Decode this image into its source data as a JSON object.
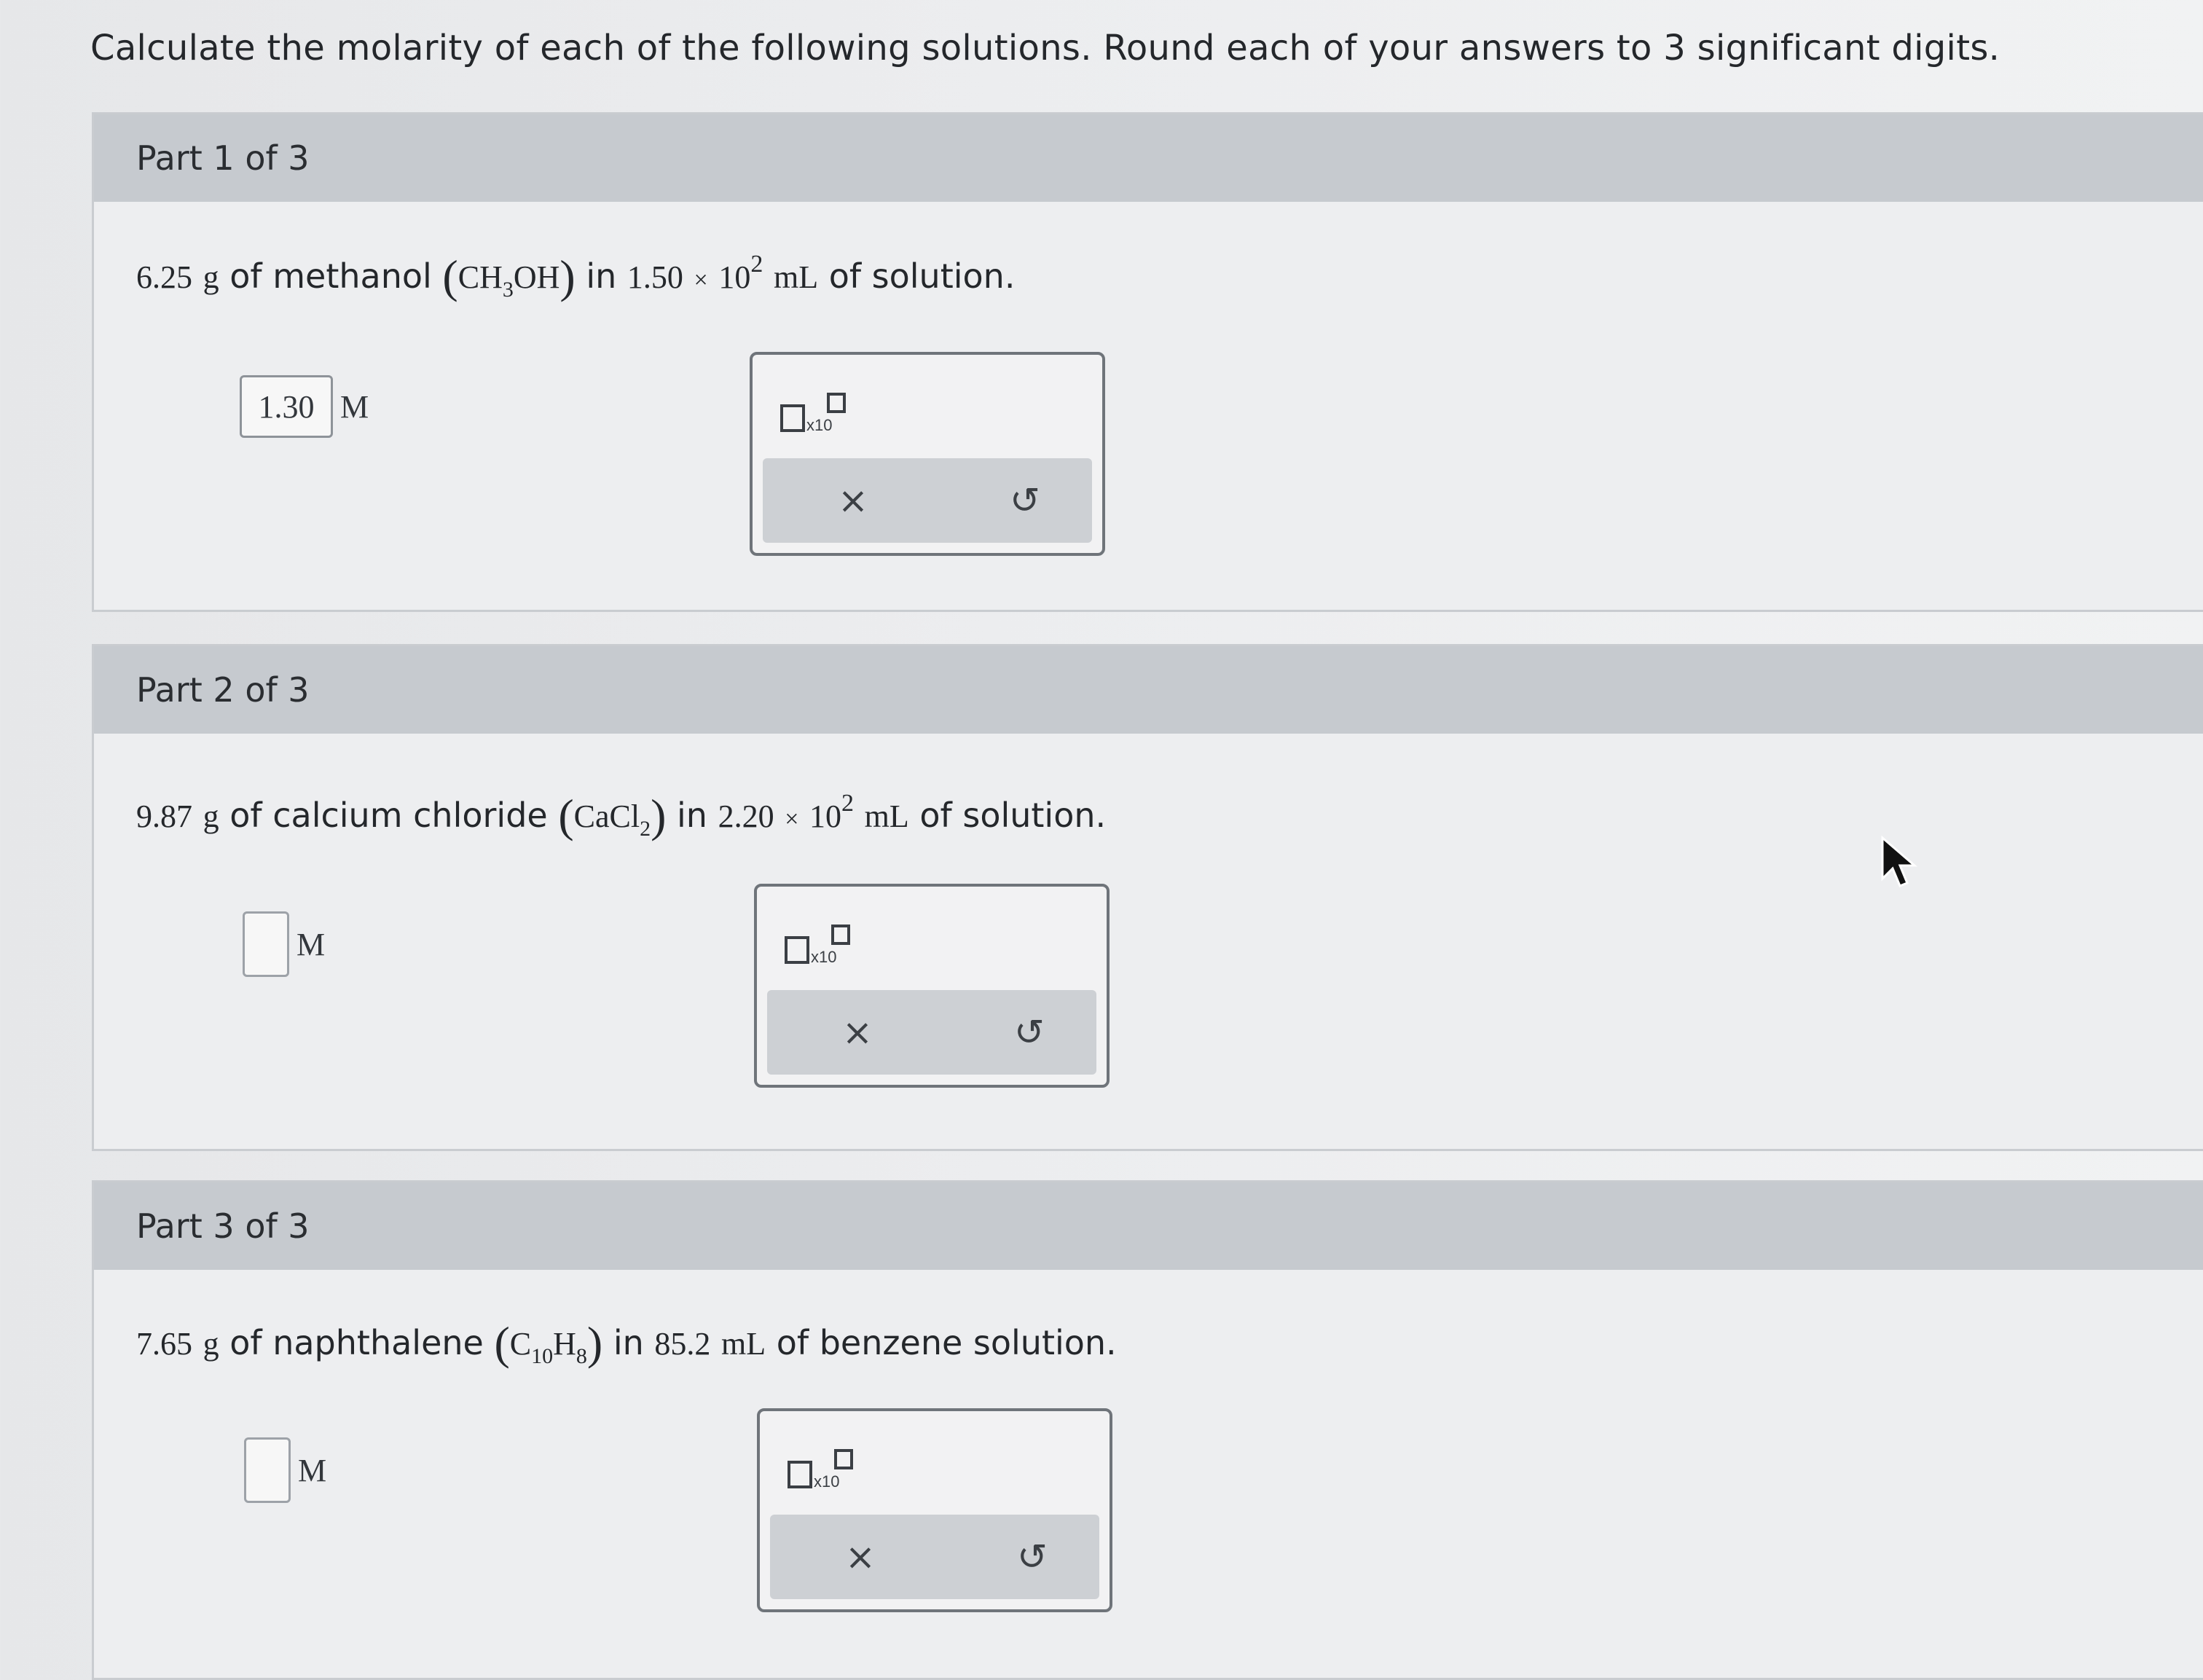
{
  "instructions": "Calculate the molarity of each of the following solutions. Round each of your answers to 3 significant digits.",
  "parts": [
    {
      "header": "Part 1 of 3",
      "mass_value": "6.25",
      "mass_unit": "g",
      "text_of": "of methanol",
      "formula": {
        "a": "CH",
        "a_sub": "3",
        "b": "OH",
        "b_sub": ""
      },
      "text_in": "in",
      "volume_mantissa": "1.50",
      "times": "×",
      "volume_base": "10",
      "volume_exp": "2",
      "volume_unit": "mL",
      "text_end": "of solution.",
      "answer_value": "1.30",
      "answer_unit": "M"
    },
    {
      "header": "Part 2 of 3",
      "mass_value": "9.87",
      "mass_unit": "g",
      "text_of": "of calcium chloride",
      "formula": {
        "a": "CaCl",
        "a_sub": "2"
      },
      "text_in": "in",
      "volume_mantissa": "2.20",
      "times": "×",
      "volume_base": "10",
      "volume_exp": "2",
      "volume_unit": "mL",
      "text_end": "of solution.",
      "answer_value": "",
      "answer_unit": "M"
    },
    {
      "header": "Part 3 of 3",
      "mass_value": "7.65",
      "mass_unit": "g",
      "text_of": "of naphthalene",
      "formula": {
        "a": "C",
        "a_sub": "10",
        "b": "H",
        "b_sub": "8"
      },
      "text_in": "in",
      "volume": "85.2",
      "volume_unit": "mL",
      "text_end": "of benzene solution.",
      "answer_value": "",
      "answer_unit": "M"
    }
  ],
  "tool_panel": {
    "sci_notation_label": "x10",
    "clear_symbol": "×",
    "undo_symbol": "↺"
  },
  "colors": {
    "header_bg": "#c6cacf",
    "panel_border": "#6f747a",
    "tool_bar": "#cdd0d4"
  }
}
